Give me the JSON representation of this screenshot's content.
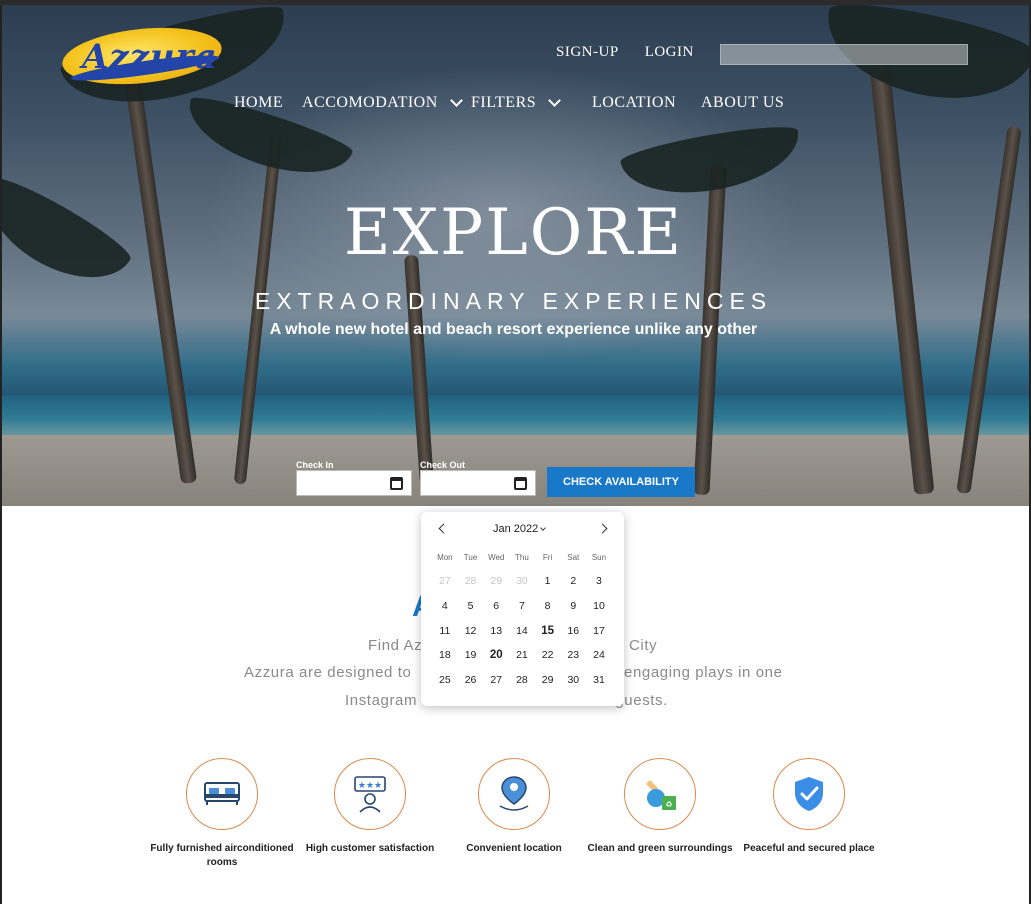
{
  "brand": {
    "logo_text": "Azzura"
  },
  "header": {
    "signup_label": "SIGN-UP",
    "login_label": "LOGIN",
    "search_placeholder": ""
  },
  "nav": {
    "home": "HOME",
    "accomodation": "ACCOMODATION",
    "filters": "FILTERS",
    "location": "LOCATION",
    "about": "ABOUT US"
  },
  "hero": {
    "title": "EXPLORE",
    "subtitle": "EXTRAORDINARY EXPERIENCES",
    "tagline": "A whole new hotel and beach resort experience unlike any other"
  },
  "booking": {
    "check_in_label": "Check In",
    "check_out_label": "Check Out",
    "check_in_value": "",
    "check_out_value": "",
    "button_label": "CHECK AVAILABILITY"
  },
  "calendar": {
    "month_label": "Jan 2022",
    "weekdays": [
      "Mon",
      "Tue",
      "Wed",
      "Thu",
      "Fri",
      "Sat",
      "Sun"
    ],
    "days": [
      {
        "d": "27",
        "muted": true
      },
      {
        "d": "28",
        "muted": true
      },
      {
        "d": "29",
        "muted": true
      },
      {
        "d": "30",
        "muted": true
      },
      {
        "d": "1"
      },
      {
        "d": "2"
      },
      {
        "d": "3"
      },
      {
        "d": "4"
      },
      {
        "d": "5"
      },
      {
        "d": "6"
      },
      {
        "d": "7"
      },
      {
        "d": "8"
      },
      {
        "d": "9"
      },
      {
        "d": "10"
      },
      {
        "d": "11"
      },
      {
        "d": "12"
      },
      {
        "d": "13"
      },
      {
        "d": "14"
      },
      {
        "d": "15",
        "bold": true
      },
      {
        "d": "16"
      },
      {
        "d": "17"
      },
      {
        "d": "18"
      },
      {
        "d": "19"
      },
      {
        "d": "20",
        "bold": true
      },
      {
        "d": "21"
      },
      {
        "d": "22"
      },
      {
        "d": "23"
      },
      {
        "d": "24"
      },
      {
        "d": "25"
      },
      {
        "d": "26"
      },
      {
        "d": "27"
      },
      {
        "d": "28"
      },
      {
        "d": "29"
      },
      {
        "d": "30"
      },
      {
        "d": "31"
      }
    ]
  },
  "about": {
    "heading_fragment": "A",
    "line1_left": "Find Az",
    "line1_right": "City",
    "line2_left": "Azzura are designed to",
    "line2_right": "engaging plays in one",
    "line3_left": "Instagram",
    "line3_right": "r guests."
  },
  "features": [
    {
      "icon": "bed-icon",
      "label": "Fully furnished airconditioned rooms"
    },
    {
      "icon": "customer-rating-icon",
      "label": "High customer satisfaction"
    },
    {
      "icon": "location-pin-icon",
      "label": "Convenient location"
    },
    {
      "icon": "eco-recycle-icon",
      "label": "Clean and green surroundings"
    },
    {
      "icon": "shield-check-icon",
      "label": "Peaceful and secured place"
    }
  ],
  "colors": {
    "accent": "#1979c8",
    "feature_ring": "#d98a4f",
    "logo_yellow": "#f4c21b",
    "logo_blue": "#2344a8"
  }
}
